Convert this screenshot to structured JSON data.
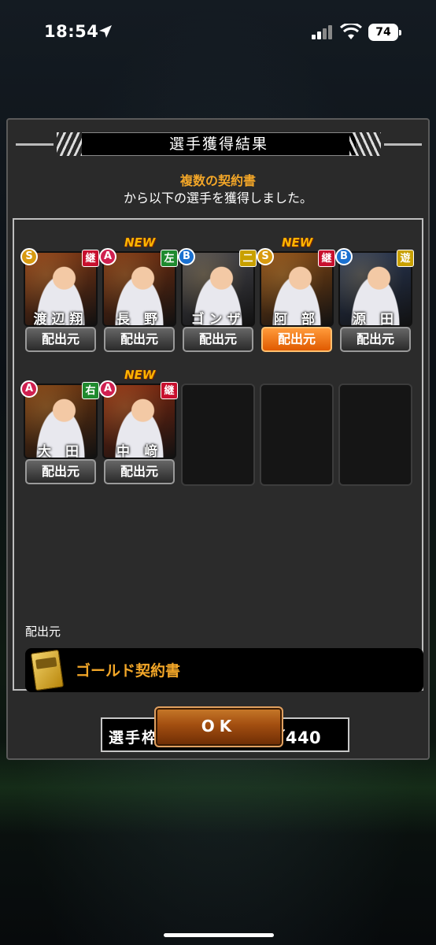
{
  "status": {
    "time": "18:54",
    "battery": "74"
  },
  "dialog": {
    "title": "選手獲得結果",
    "subtitle_highlight": "複数の契約書",
    "subtitle": "から以下の選手を獲得しました。",
    "players": [
      {
        "name": "渡辺翔",
        "rank": "S",
        "rank_color": "#d89a10",
        "position": "継",
        "pos_color": "#c8102e",
        "new": "",
        "bg": "#8a3a14",
        "btn": "配出元",
        "active": false
      },
      {
        "name": "長 野",
        "rank": "A",
        "rank_color": "#d02050",
        "position": "左",
        "pos_color": "#1f8a2e",
        "new": "NEW",
        "bg": "#7a3010",
        "btn": "配出元",
        "active": false
      },
      {
        "name": "ゴンザレス",
        "rank": "B",
        "rank_color": "#1a70d0",
        "position": "二",
        "pos_color": "#c8a000",
        "new": "",
        "bg": "#4a4a52",
        "btn": "配出元",
        "active": false
      },
      {
        "name": "阿 部",
        "rank": "S",
        "rank_color": "#d89a10",
        "position": "継",
        "pos_color": "#c8102e",
        "new": "NEW",
        "bg": "#8a4a14",
        "btn": "配出元",
        "active": true
      },
      {
        "name": "源 田",
        "rank": "B",
        "rank_color": "#1a70d0",
        "position": "遊",
        "pos_color": "#c8a000",
        "new": "",
        "bg": "#2a3a5a",
        "btn": "配出元",
        "active": false
      },
      {
        "name": "大 田",
        "rank": "A",
        "rank_color": "#d02050",
        "position": "右",
        "pos_color": "#1f8a2e",
        "new": "",
        "bg": "#7a3a10",
        "btn": "配出元",
        "active": false
      },
      {
        "name": "中 﨑",
        "rank": "A",
        "rank_color": "#d02050",
        "position": "継",
        "pos_color": "#c8102e",
        "new": "NEW",
        "bg": "#8a2a10",
        "btn": "配出元",
        "active": false
      }
    ],
    "source_label": "配出元",
    "source_name": "ゴールド契約書",
    "slot_label": "選手枠：",
    "slot_value": "403／440",
    "ok_label": "OK"
  }
}
